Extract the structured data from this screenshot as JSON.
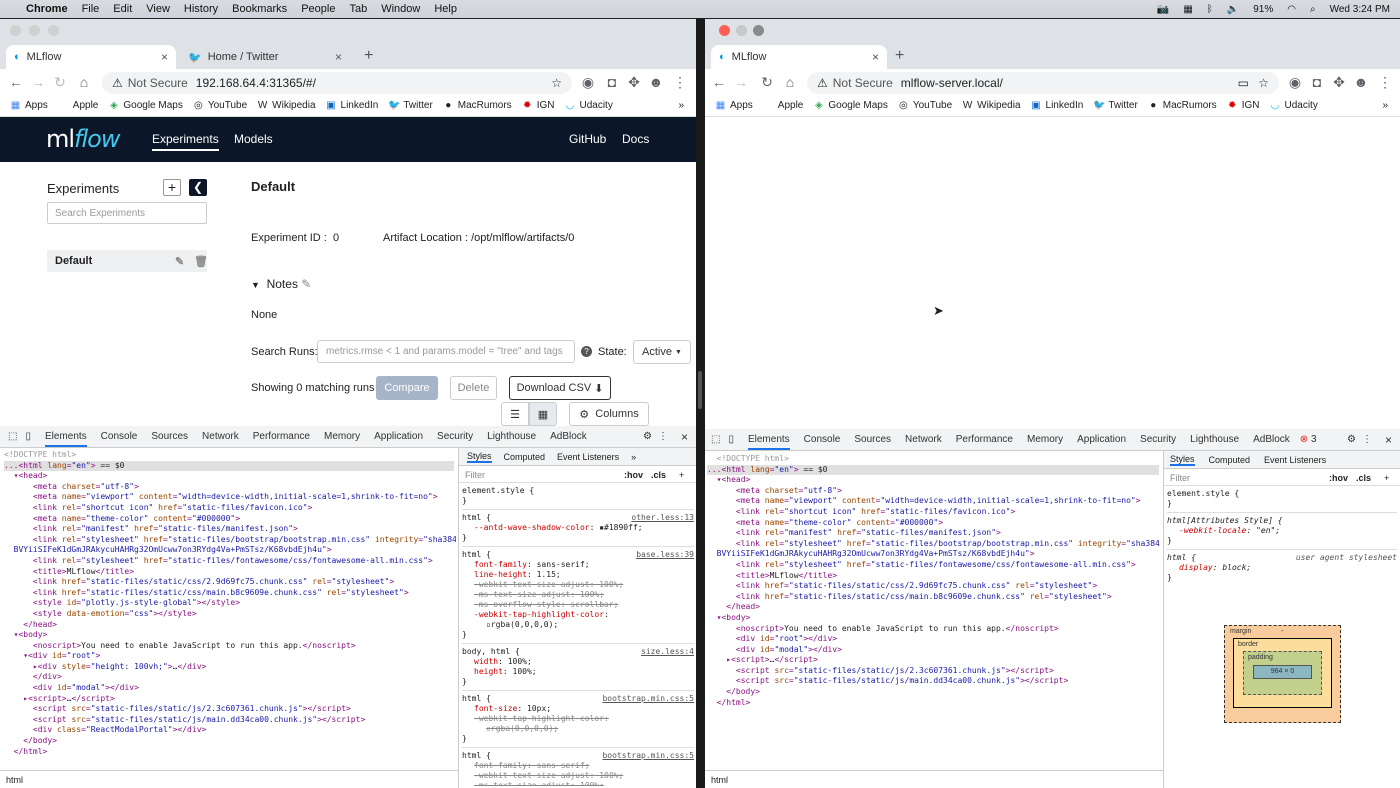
{
  "menubar": {
    "apple": "",
    "app": "Chrome",
    "items": [
      "File",
      "Edit",
      "View",
      "History",
      "Bookmarks",
      "People",
      "Tab",
      "Window",
      "Help"
    ],
    "battery": "91%",
    "clock": "Wed 3:24 PM"
  },
  "left": {
    "tabs": [
      {
        "label": "MLflow"
      },
      {
        "label": "Home / Twitter"
      }
    ],
    "url_prefix": "Not Secure",
    "url": "192.168.64.4:31365/#/",
    "bookmarks": [
      "Apps",
      "Apple",
      "Google Maps",
      "YouTube",
      "Wikipedia",
      "LinkedIn",
      "Twitter",
      "MacRumors",
      "IGN",
      "Udacity"
    ],
    "ml": {
      "logo_a": "ml",
      "logo_b": "flow",
      "nav": [
        "Experiments",
        "Models"
      ],
      "nav_right": [
        "GitHub",
        "Docs"
      ],
      "sidebar_title": "Experiments",
      "search_placeholder": "Search Experiments",
      "experiment": "Default",
      "title": "Default",
      "exp_id_label": "Experiment ID :",
      "exp_id": "0",
      "artifact_label": "Artifact Location :",
      "artifact": "/opt/mlflow/artifacts/0",
      "notes_label": "Notes",
      "notes_value": "None",
      "search_runs_label": "Search Runs:",
      "search_runs_placeholder": "metrics.rmse < 1 and params.model = \"tree\" and tags",
      "state_label": "State:",
      "state_value": "Active",
      "showing": "Showing 0 matching runs",
      "compare": "Compare",
      "delete": "Delete",
      "download": "Download CSV",
      "columns": "Columns"
    },
    "devtools": {
      "tabs": [
        "Elements",
        "Console",
        "Sources",
        "Network",
        "Performance",
        "Memory",
        "Application",
        "Security",
        "Lighthouse",
        "AdBlock"
      ],
      "styles_tabs": [
        "Styles",
        "Computed",
        "Event Listeners"
      ],
      "filter": "Filter",
      "hov": ":hov",
      "cls": ".cls",
      "breadcrumb": "html"
    }
  },
  "right": {
    "tabs": [
      {
        "label": "MLflow"
      }
    ],
    "url_prefix": "Not Secure",
    "url": "mlflow-server.local/",
    "bookmarks": [
      "Apps",
      "Apple",
      "Google Maps",
      "YouTube",
      "Wikipedia",
      "LinkedIn",
      "Twitter",
      "MacRumors",
      "IGN",
      "Udacity"
    ],
    "devtools": {
      "tabs": [
        "Elements",
        "Console",
        "Sources",
        "Network",
        "Performance",
        "Memory",
        "Application",
        "Security",
        "Lighthouse",
        "AdBlock"
      ],
      "errors": "3",
      "styles_tabs": [
        "Styles",
        "Computed",
        "Event Listeners"
      ],
      "filter": "Filter",
      "hov": ":hov",
      "cls": ".cls",
      "breadcrumb": "html",
      "box": {
        "margin": "margin",
        "border": "border",
        "padding": "padding",
        "content": "964 × 0",
        "dash": "-"
      }
    }
  }
}
